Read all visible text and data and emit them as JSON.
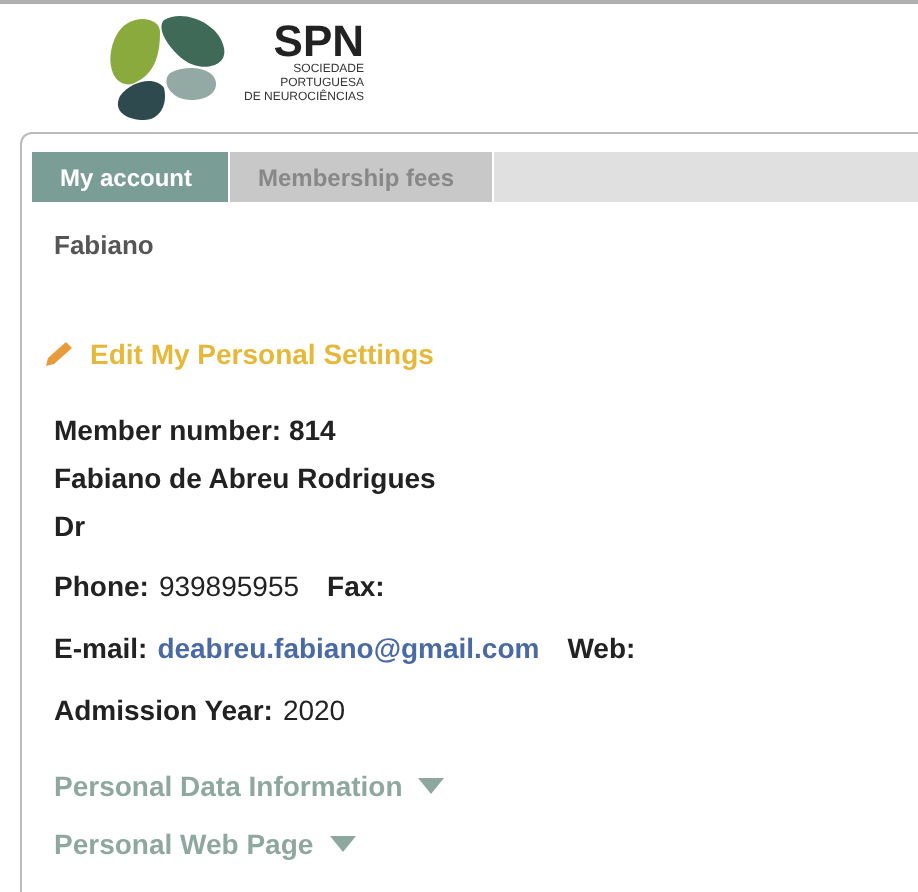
{
  "logo": {
    "acronym": "SPN",
    "name_lines": [
      "SOCIEDADE",
      "PORTUGUESA",
      "DE NEUROCIÊNCIAS"
    ]
  },
  "tabs": [
    {
      "label": "My account",
      "selected": true
    },
    {
      "label": "Membership fees",
      "selected": false
    }
  ],
  "username": "Fabiano",
  "edit_link": "Edit My Personal Settings",
  "heading_lines": [
    "Member number: 814",
    "Fabiano de Abreu Rodrigues",
    "Dr"
  ],
  "info_rows": [
    [
      {
        "label": "Phone:",
        "value": "939895955",
        "kind": "text"
      },
      {
        "label": "Fax:"
      }
    ],
    [
      {
        "label": "E-mail:",
        "value": "deabreu.fabiano@gmail.com",
        "kind": "link"
      },
      {
        "label": "Web:"
      }
    ],
    [
      {
        "label": "Admission Year:",
        "value": "2020",
        "kind": "text"
      }
    ]
  ],
  "sections": [
    {
      "label": "Personal Data Information",
      "expanded": false
    },
    {
      "label": "Personal Web Page",
      "expanded": false
    }
  ]
}
